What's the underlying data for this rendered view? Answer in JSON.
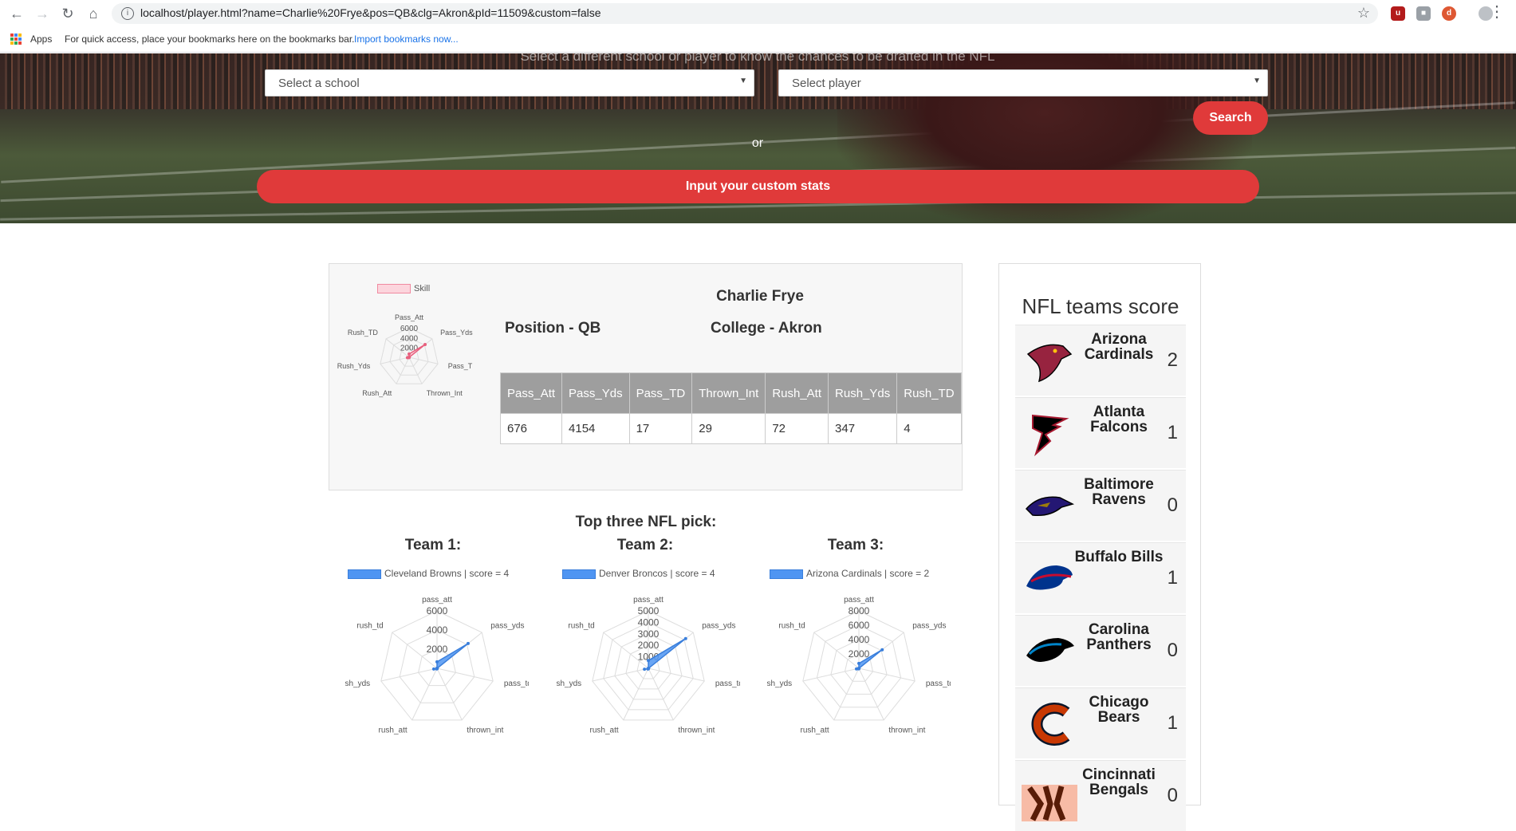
{
  "browser": {
    "url": "localhost/player.html?name=Charlie%20Frye&pos=QB&clg=Akron&pId=11509&custom=false",
    "apps_label": "Apps",
    "bookmarks_hint": "For quick access, place your bookmarks here on the bookmarks bar.",
    "import_link": "Import bookmarks now..."
  },
  "hero": {
    "tagline": "Select a different school or player to know the chances to be drafted in the NFL",
    "school_select": "Select a school",
    "player_select": "Select player",
    "search_label": "Search",
    "or_label": "or",
    "custom_label": "Input your custom stats"
  },
  "player": {
    "name": "Charlie Frye",
    "position": "Position - QB",
    "college": "College - Akron",
    "legend": "Skill",
    "columns": [
      "Pass_Att",
      "Pass_Yds",
      "Pass_TD",
      "Thrown_Int",
      "Rush_Att",
      "Rush_Yds",
      "Rush_TD"
    ],
    "values": [
      "676",
      "4154",
      "17",
      "29",
      "72",
      "347",
      "4"
    ]
  },
  "chart_data": [
    {
      "type": "radar",
      "axes": [
        "Pass_Att",
        "Pass_Yds",
        "Pass_TD",
        "Thrown_Int",
        "Rush_Att",
        "Rush_Yds",
        "Rush_TD"
      ],
      "ticks": [
        2000,
        4000,
        6000
      ],
      "rmax": 6000,
      "series": [
        {
          "name": "Skill",
          "values": [
            676,
            4154,
            17,
            29,
            72,
            347,
            4
          ]
        }
      ]
    },
    {
      "type": "radar",
      "axes": [
        "pass_att",
        "pass_yds",
        "pass_td",
        "thrown_int",
        "rush_att",
        "rush_yds",
        "rush_td"
      ],
      "ticks": [
        2000,
        4000,
        6000
      ],
      "rmax": 6000,
      "series": [
        {
          "name": "Cleveland Browns |  score = 4",
          "values": [
            676,
            4154,
            17,
            29,
            72,
            347,
            4
          ]
        }
      ]
    },
    {
      "type": "radar",
      "axes": [
        "pass_att",
        "pass_yds",
        "pass_td",
        "thrown_int",
        "rush_att",
        "rush_yds",
        "rush_td"
      ],
      "ticks": [
        1000,
        2000,
        3000,
        4000,
        5000
      ],
      "rmax": 5000,
      "series": [
        {
          "name": "Denver Broncos |  score = 4",
          "values": [
            676,
            4154,
            17,
            29,
            72,
            347,
            4
          ]
        }
      ]
    },
    {
      "type": "radar",
      "axes": [
        "pass_att",
        "pass_yds",
        "pass_td",
        "thrown_int",
        "rush_att",
        "rush_yds",
        "rush_td"
      ],
      "ticks": [
        2000,
        4000,
        6000,
        8000
      ],
      "rmax": 8000,
      "series": [
        {
          "name": "Arizona Cardinals |  score = 2",
          "values": [
            676,
            4154,
            17,
            29,
            72,
            347,
            4
          ]
        }
      ]
    }
  ],
  "picks": {
    "title": "Top three NFL pick:",
    "teams": [
      {
        "title": "Team 1:",
        "legend": "Cleveland Browns |  score = 4"
      },
      {
        "title": "Team 2:",
        "legend": "Denver Broncos |  score = 4"
      },
      {
        "title": "Team 3:",
        "legend": "Arizona Cardinals |  score = 2"
      }
    ]
  },
  "scores": {
    "title": "NFL teams score",
    "teams": [
      {
        "name": "Arizona Cardinals",
        "score": "2",
        "icon": "cardinal-logo-icon",
        "color": "#97233f"
      },
      {
        "name": "Atlanta Falcons",
        "score": "1",
        "icon": "falcon-logo-icon",
        "color": "#a71930"
      },
      {
        "name": "Baltimore Ravens",
        "score": "0",
        "icon": "raven-logo-icon",
        "color": "#241773"
      },
      {
        "name": "Buffalo Bills",
        "score": "1",
        "icon": "bison-logo-icon",
        "color": "#00338d"
      },
      {
        "name": "Carolina Panthers",
        "score": "0",
        "icon": "panther-logo-icon",
        "color": "#0085ca"
      },
      {
        "name": "Chicago Bears",
        "score": "1",
        "icon": "bears-c-logo-icon",
        "color": "#c83803"
      },
      {
        "name": "Cincinnati Bengals",
        "score": "0",
        "icon": "bengals-logo-icon",
        "color": "#fb4f14"
      }
    ]
  },
  "colors": {
    "accent": "#e03a3a",
    "radar_blue": "#4f95f2",
    "skill_pink": "#f08aa0",
    "table_header": "#9e9e9e"
  }
}
